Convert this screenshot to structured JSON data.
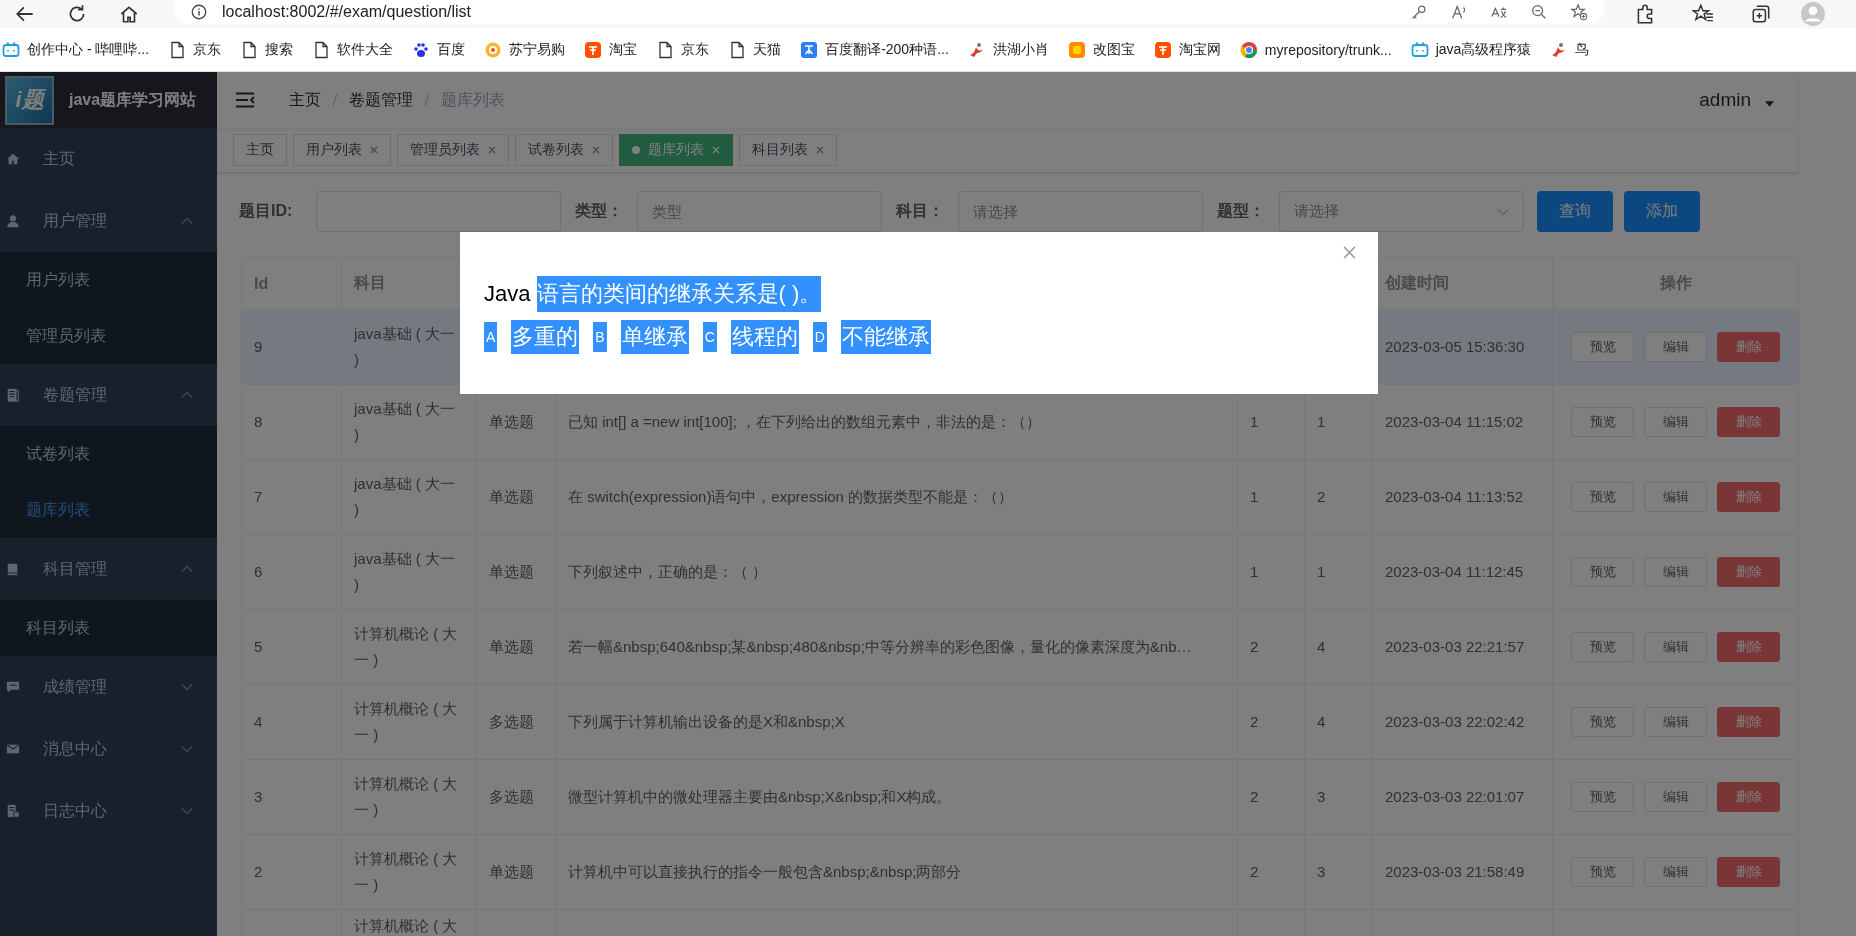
{
  "browser": {
    "address": "localhost:8002/#/exam/question/list",
    "bookmarks": [
      {
        "label": "创作中心 - 哔哩哔...",
        "kind": "tv"
      },
      {
        "label": "京东",
        "kind": "page"
      },
      {
        "label": "搜索",
        "kind": "page"
      },
      {
        "label": "软件大全",
        "kind": "page"
      },
      {
        "label": "百度",
        "kind": "paw"
      },
      {
        "label": "苏宁易购",
        "kind": "circle"
      },
      {
        "label": "淘宝",
        "kind": "tao"
      },
      {
        "label": "京东",
        "kind": "page"
      },
      {
        "label": "天猫",
        "kind": "page"
      },
      {
        "label": "百度翻译-200种语...",
        "kind": "translate"
      },
      {
        "label": "洪湖小肖",
        "kind": "bird"
      },
      {
        "label": "改图宝",
        "kind": "square"
      },
      {
        "label": "淘宝网",
        "kind": "tao"
      },
      {
        "label": "myrepository/trunk...",
        "kind": "globe"
      },
      {
        "label": "java高级程序猿",
        "kind": "tv"
      },
      {
        "label": "鸟",
        "kind": "bird"
      }
    ]
  },
  "sidebar": {
    "logo_mark": "i题",
    "title": "java题库学习网站",
    "items": [
      {
        "label": "主页",
        "kind": "home"
      },
      {
        "label": "用户管理",
        "kind": "user",
        "expanded": true,
        "children": [
          {
            "label": "用户列表",
            "selected": false
          },
          {
            "label": "管理员列表",
            "selected": false
          }
        ]
      },
      {
        "label": "卷题管理",
        "kind": "doc",
        "expanded": true,
        "children": [
          {
            "label": "试卷列表",
            "selected": false
          },
          {
            "label": "题库列表",
            "selected": true
          }
        ]
      },
      {
        "label": "科目管理",
        "kind": "book",
        "expanded": true,
        "children": [
          {
            "label": "科目列表",
            "selected": false
          }
        ]
      },
      {
        "label": "成绩管理",
        "kind": "chat",
        "expanded": false
      },
      {
        "label": "消息中心",
        "kind": "mail",
        "expanded": false
      },
      {
        "label": "日志中心",
        "kind": "log",
        "expanded": false
      }
    ]
  },
  "header": {
    "breadcrumb": [
      {
        "label": "主页",
        "current": false
      },
      {
        "label": "卷题管理",
        "current": false
      },
      {
        "label": "题库列表",
        "current": true
      }
    ],
    "user": "admin"
  },
  "tags": [
    {
      "label": "主页",
      "selected": false,
      "closable": false
    },
    {
      "label": "用户列表",
      "selected": false,
      "closable": true
    },
    {
      "label": "管理员列表",
      "selected": false,
      "closable": true
    },
    {
      "label": "试卷列表",
      "selected": false,
      "closable": true
    },
    {
      "label": "题库列表",
      "selected": true,
      "closable": true
    },
    {
      "label": "科目列表",
      "selected": false,
      "closable": true
    }
  ],
  "filters": {
    "fields": [
      {
        "label": "题目ID:",
        "kind": "input"
      },
      {
        "label": "类型：",
        "placeholder": "类型",
        "kind": "input"
      },
      {
        "label": "科目：",
        "placeholder": "请选择",
        "kind": "input"
      },
      {
        "label": "题型：",
        "placeholder": "请选择",
        "kind": "select"
      }
    ],
    "buttons": [
      "查询",
      "添加"
    ]
  },
  "table": {
    "columns": [
      {
        "label": "Id"
      },
      {
        "label": "科目"
      },
      {},
      {},
      {},
      {},
      {
        "label": "创建时间"
      },
      {
        "label": "操作"
      }
    ],
    "rows": [
      {
        "id": "9",
        "subject": "java基础 ( 大一 )",
        "created": "2023-03-05 15:36:30",
        "highlighted": true,
        "actions": [
          {
            "label": "预览",
            "kind": "default"
          },
          {
            "label": "编辑",
            "kind": "default"
          },
          {
            "label": "删除",
            "kind": "danger"
          }
        ]
      },
      {
        "id": "8",
        "subject": "java基础 ( 大一 )",
        "type": "单选题",
        "content": "已知 int[] a =new int[100]; ，在下列给出的数组元素中，非法的是：（）",
        "column_5": "1",
        "column_6": "1",
        "created": "2023-03-04 11:15:02",
        "highlighted": false,
        "actions": [
          {
            "label": "预览",
            "kind": "default"
          },
          {
            "label": "编辑",
            "kind": "default"
          },
          {
            "label": "删除",
            "kind": "danger"
          }
        ]
      },
      {
        "id": "7",
        "subject": "java基础 ( 大一 )",
        "type": "单选题",
        "content": "在 switch(expression)语句中，expression 的数据类型不能是：（）",
        "column_5": "1",
        "column_6": "2",
        "created": "2023-03-04 11:13:52",
        "highlighted": false,
        "actions": [
          {
            "label": "预览",
            "kind": "default"
          },
          {
            "label": "编辑",
            "kind": "default"
          },
          {
            "label": "删除",
            "kind": "danger"
          }
        ]
      },
      {
        "id": "6",
        "subject": "java基础 ( 大一 )",
        "type": "单选题",
        "content": "下列叙述中，正确的是：（ ）",
        "column_5": "1",
        "column_6": "1",
        "created": "2023-03-04 11:12:45",
        "highlighted": false,
        "actions": [
          {
            "label": "预览",
            "kind": "default"
          },
          {
            "label": "编辑",
            "kind": "default"
          },
          {
            "label": "删除",
            "kind": "danger"
          }
        ]
      },
      {
        "id": "5",
        "subject": "计算机概论 ( 大一 )",
        "type": "单选题",
        "content": "若一幅&nbsp;640&nbsp;某&nbsp;480&nbsp;中等分辨率的彩色图像，量化的像素深度为&nb…",
        "column_5": "2",
        "column_6": "4",
        "created": "2023-03-03 22:21:57",
        "highlighted": false,
        "actions": [
          {
            "label": "预览",
            "kind": "default"
          },
          {
            "label": "编辑",
            "kind": "default"
          },
          {
            "label": "删除",
            "kind": "danger"
          }
        ]
      },
      {
        "id": "4",
        "subject": "计算机概论 ( 大一 )",
        "type": "多选题",
        "content": "下列属于计算机输出设备的是X和&nbsp;X",
        "column_5": "2",
        "column_6": "4",
        "created": "2023-03-03 22:02:42",
        "highlighted": false,
        "actions": [
          {
            "label": "预览",
            "kind": "default"
          },
          {
            "label": "编辑",
            "kind": "default"
          },
          {
            "label": "删除",
            "kind": "danger"
          }
        ]
      },
      {
        "id": "3",
        "subject": "计算机概论 ( 大一 )",
        "type": "多选题",
        "content": "微型计算机中的微处理器主要由&nbsp;X&nbsp;和X构成。",
        "column_5": "2",
        "column_6": "3",
        "created": "2023-03-03 22:01:07",
        "highlighted": false,
        "actions": [
          {
            "label": "预览",
            "kind": "default"
          },
          {
            "label": "编辑",
            "kind": "default"
          },
          {
            "label": "删除",
            "kind": "danger"
          }
        ]
      },
      {
        "id": "2",
        "subject": "计算机概论 ( 大一 )",
        "type": "单选题",
        "content": "计算机中可以直接执行的指令一般包含&nbsp;&nbsp;两部分",
        "column_5": "2",
        "column_6": "3",
        "created": "2023-03-03 21:58:49",
        "highlighted": false,
        "actions": [
          {
            "label": "预览",
            "kind": "default"
          },
          {
            "label": "编辑",
            "kind": "default"
          },
          {
            "label": "删除",
            "kind": "danger"
          }
        ]
      },
      {
        "subject": "计算机概论 ( 大"
      }
    ]
  },
  "modal": {
    "question": [
      {
        "text": "Java ",
        "highlighted": false
      },
      {
        "text": "语言的类间的继承关系是( )。",
        "highlighted": true
      }
    ],
    "options": [
      {
        "letter": "A",
        "text": "多重的",
        "highlighted": true
      },
      {
        "letter": "B",
        "text": "单继承",
        "highlighted": true
      },
      {
        "letter": "C",
        "text": "线程的",
        "highlighted": true
      },
      {
        "letter": "D",
        "text": "不能继承",
        "highlighted": true
      }
    ]
  }
}
